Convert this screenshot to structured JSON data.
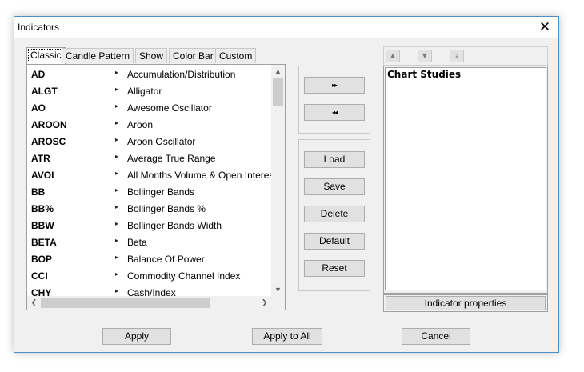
{
  "window": {
    "title": "Indicators",
    "close_glyph": "✕"
  },
  "tabs": [
    {
      "label": "Classic",
      "active": true
    },
    {
      "label": "Candle Pattern",
      "active": false
    },
    {
      "label": "Show",
      "active": false
    },
    {
      "label": "Color Bar",
      "active": false
    },
    {
      "label": "Custom",
      "active": false
    }
  ],
  "indicator_list": [
    {
      "code": "AD",
      "name": "Accumulation/Distribution"
    },
    {
      "code": "ALGT",
      "name": "Alligator"
    },
    {
      "code": "AO",
      "name": "Awesome Oscillator"
    },
    {
      "code": "AROON",
      "name": "Aroon"
    },
    {
      "code": "AROSC",
      "name": "Aroon Oscillator"
    },
    {
      "code": "ATR",
      "name": "Average True Range"
    },
    {
      "code": "AVOI",
      "name": "All Months Volume & Open Interest"
    },
    {
      "code": "BB",
      "name": "Bollinger Bands"
    },
    {
      "code": "BB%",
      "name": "Bollinger Bands %"
    },
    {
      "code": "BBW",
      "name": "Bollinger Bands Width"
    },
    {
      "code": "BETA",
      "name": "Beta"
    },
    {
      "code": "BOP",
      "name": "Balance Of Power"
    },
    {
      "code": "CCI",
      "name": "Commodity Channel Index"
    },
    {
      "code": "CHY",
      "name": "Cash/Index"
    }
  ],
  "row_arrow_glyph": "▸",
  "scroll_glyphs": {
    "up": "▲",
    "down": "▼",
    "left": "❮",
    "right": "❯"
  },
  "transfer": {
    "add_glyph": "▸▸",
    "remove_glyph": "◂◂"
  },
  "actions": {
    "load": "Load",
    "save": "Save",
    "delete": "Delete",
    "default": "Default",
    "reset": "Reset"
  },
  "studies_toolbar": {
    "move_up_glyph": "▲",
    "move_down_glyph": "▼",
    "move_bottom_glyph": "⤓"
  },
  "studies": {
    "title": "Chart Studies",
    "properties_label": "Indicator properties"
  },
  "footer": {
    "apply": "Apply",
    "apply_all": "Apply to All",
    "cancel": "Cancel"
  }
}
